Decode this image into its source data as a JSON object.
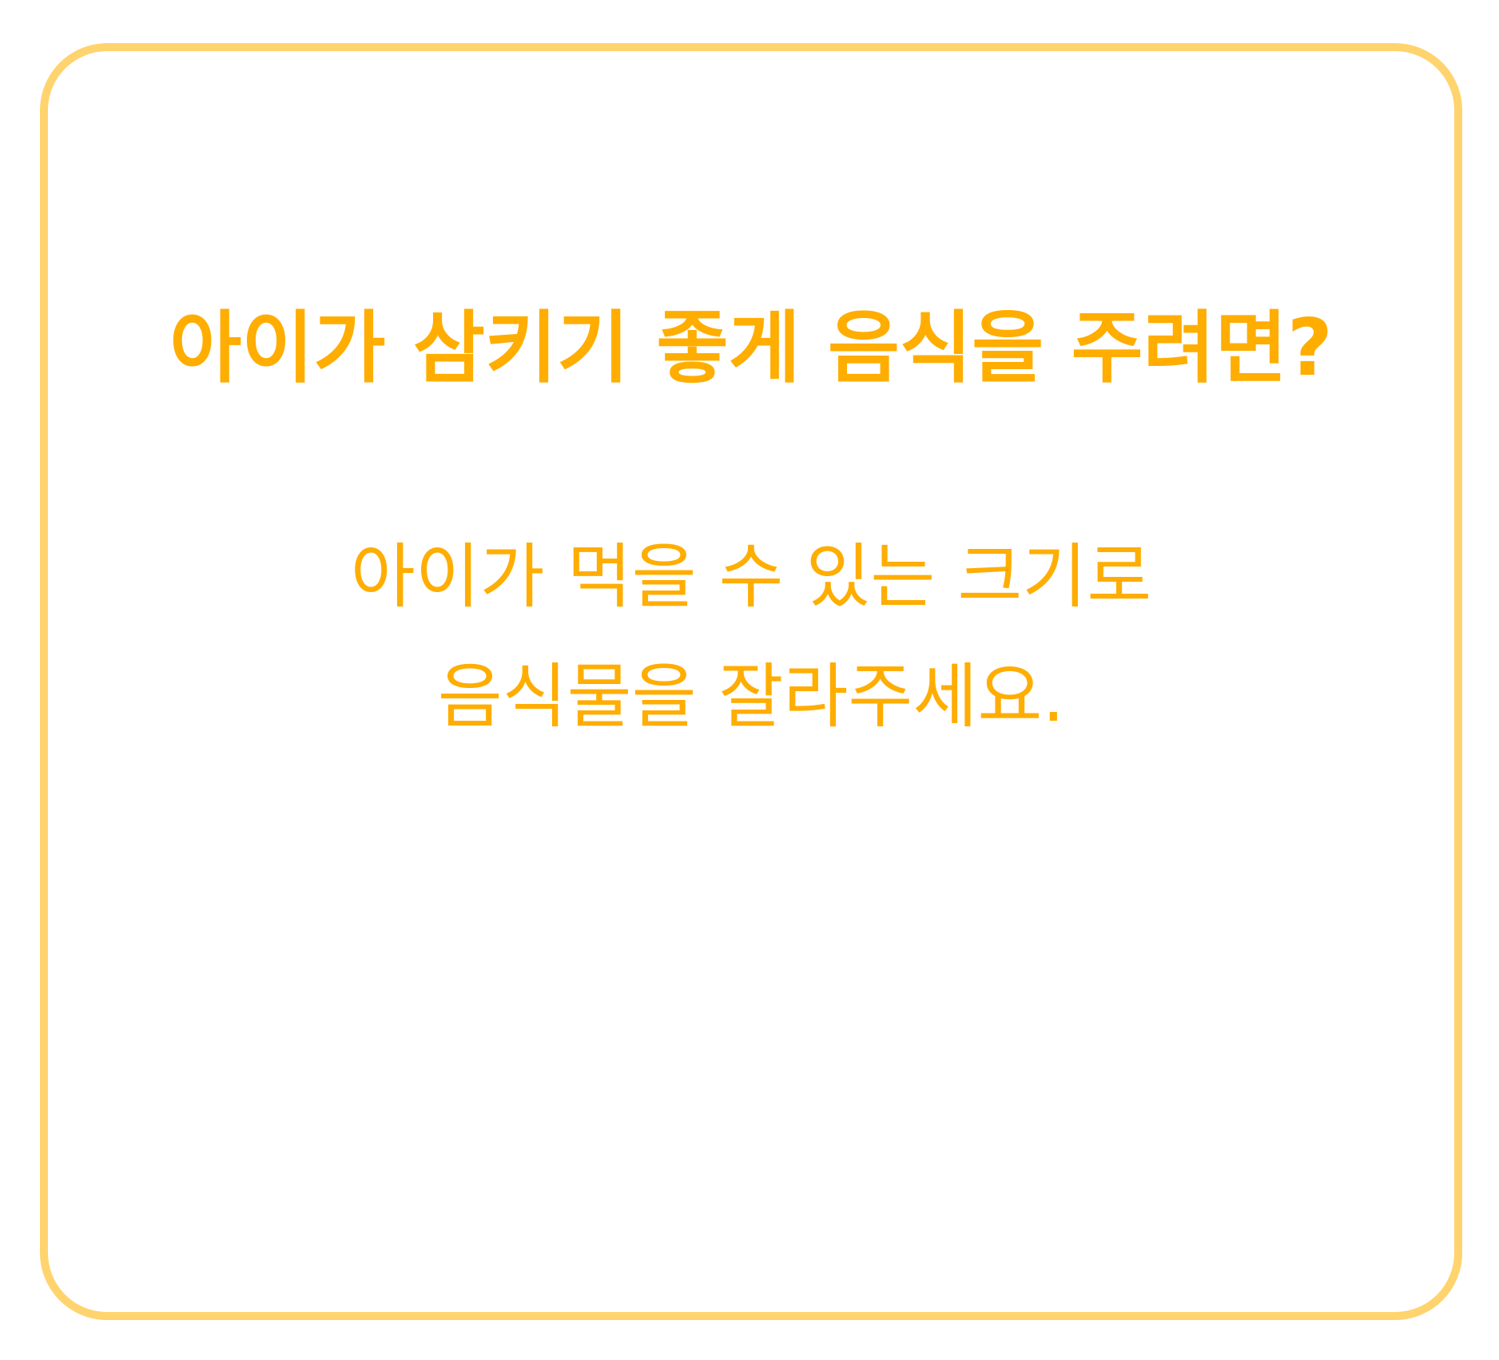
{
  "colors": {
    "accent_text": "#FFAD00",
    "card_border": "#FFD36E",
    "background": "#FFFFFF"
  },
  "card": {
    "title": "아이가 삼키기 좋게 음식을 주려면?",
    "body_lines": [
      "아이가 먹을 수 있는 크기로",
      "음식물을 잘라주세요."
    ]
  }
}
